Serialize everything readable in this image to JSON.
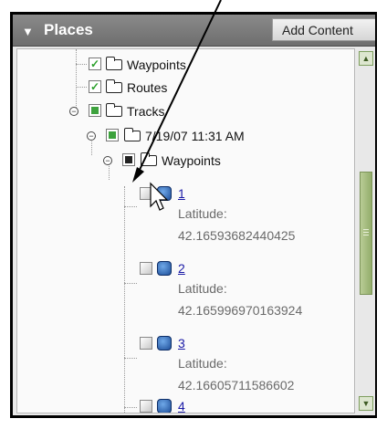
{
  "panel": {
    "title": "Places",
    "collapse_glyph": "▼",
    "add_button_label": "Add Content"
  },
  "tree": {
    "items": [
      {
        "label": "Waypoints",
        "checked": true,
        "icon": "folder-icon"
      },
      {
        "label": "Routes",
        "checked": true,
        "icon": "folder-icon"
      },
      {
        "label": "Tracks",
        "state": "partial",
        "icon": "folder-open-icon"
      },
      {
        "label": "7/19/07 11:31 AM",
        "state": "partial",
        "icon": "folder-open-icon"
      },
      {
        "label": "Waypoints",
        "state": "partial",
        "icon": "folder-open-icon"
      }
    ],
    "waypoints": [
      {
        "name": "1",
        "lat_label": "Latitude:",
        "lat_value": "42.16593682440425"
      },
      {
        "name": "2",
        "lat_label": "Latitude:",
        "lat_value": "42.165996970163924"
      },
      {
        "name": "3",
        "lat_label": "Latitude:",
        "lat_value": "42.16605711586602"
      },
      {
        "name": "4"
      }
    ]
  },
  "colors": {
    "header_bg": "#7a7a7a",
    "check_green": "#2aa02a",
    "link_blue": "#1a1aa6",
    "scroll_green": "#93ad6b"
  }
}
